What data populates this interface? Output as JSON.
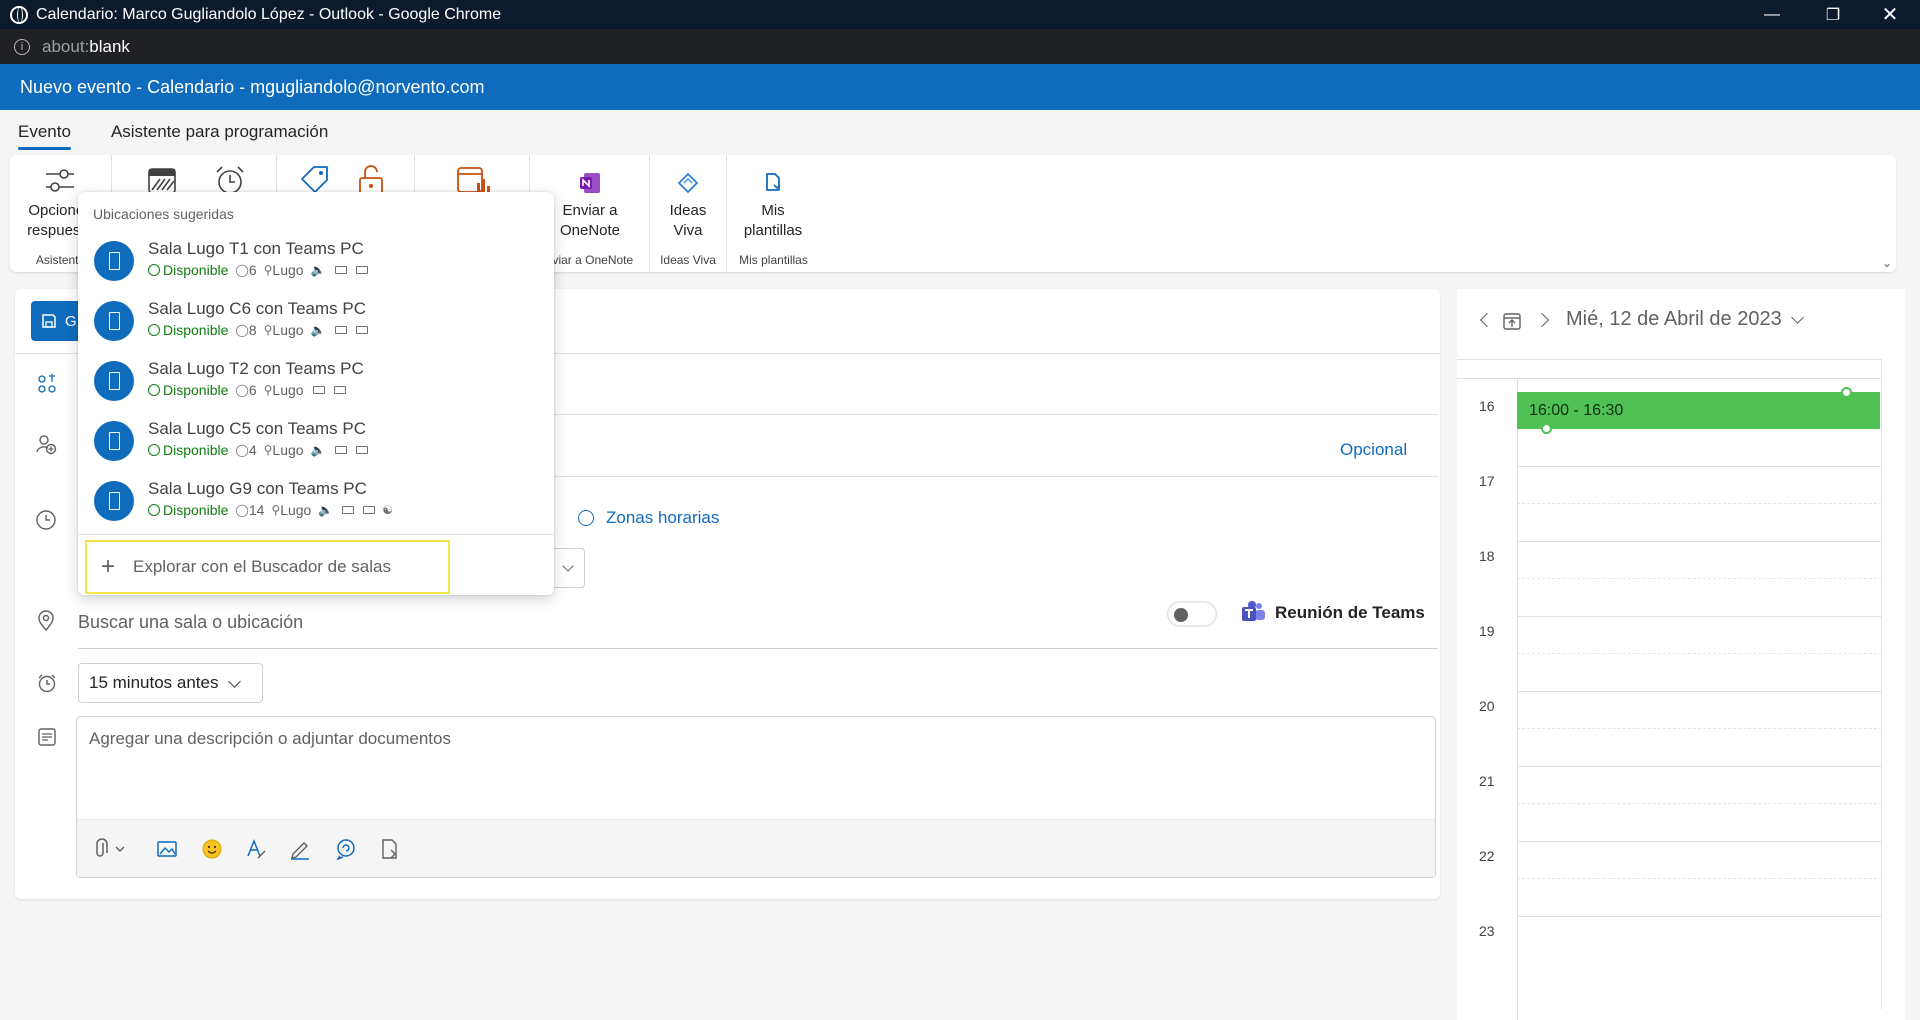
{
  "window": {
    "title": "Calendario: Marco Gugliandolo López - Outlook - Google Chrome",
    "address_scheme": "about:",
    "address_path": "blank"
  },
  "app_header": {
    "title": "Nuevo evento - Calendario - mgugliandolo@norvento.com"
  },
  "tabs": [
    {
      "label": "Evento",
      "active": true
    },
    {
      "label": "Asistente para programación",
      "active": false
    }
  ],
  "ribbon": {
    "groups": [
      {
        "buttons": [
          {
            "label_line1": "Opciones",
            "label_line2": "respuesta",
            "icon": "sliders-icon"
          }
        ],
        "group_label": "Asistente"
      },
      {
        "buttons": [
          {
            "label_line1": "",
            "label_line2": "",
            "icon": "calendar-busy-icon"
          },
          {
            "label_line1": "",
            "label_line2": "",
            "icon": "alarm-clock-icon"
          }
        ]
      },
      {
        "buttons": [
          {
            "label_line1": "",
            "label_line2": "",
            "icon": "tag-icon"
          },
          {
            "label_line1": "",
            "label_line2": "",
            "icon": "unlock-icon"
          }
        ]
      },
      {
        "buttons": [
          {
            "label_line1": "",
            "label_line2": "",
            "icon": "calendar-chart-icon"
          }
        ]
      },
      {
        "buttons": [
          {
            "label_line1": "Enviar a",
            "label_line2": "OneNote",
            "icon": "onenote-icon"
          }
        ],
        "group_label": "nviar a OneNote"
      },
      {
        "buttons": [
          {
            "label_line1": "Ideas",
            "label_line2": "Viva",
            "icon": "viva-icon"
          }
        ],
        "group_label": "Ideas Viva"
      },
      {
        "buttons": [
          {
            "label_line1": "Mis",
            "label_line2": "plantillas",
            "icon": "template-icon"
          }
        ],
        "group_label": "Mis plantillas"
      }
    ]
  },
  "event_form": {
    "save_label": "G",
    "optional_label": "Opcional",
    "timezones_label": "Zonas horarias",
    "location_placeholder": "Buscar una sala o ubicación",
    "teams_label": "Reunión de Teams",
    "teams_toggle_on": false,
    "reminder_value": "15 minutos antes",
    "description_placeholder": "Agregar una descripción o adjuntar documentos"
  },
  "suggestions": {
    "title": "Ubicaciones sugeridas",
    "items": [
      {
        "name": "Sala Lugo T1 con Teams PC",
        "status": "Disponible",
        "capacity": "6",
        "city": "Lugo"
      },
      {
        "name": "Sala Lugo C6 con Teams PC",
        "status": "Disponible",
        "capacity": "8",
        "city": "Lugo"
      },
      {
        "name": "Sala Lugo T2 con Teams PC",
        "status": "Disponible",
        "capacity": "6",
        "city": "Lugo"
      },
      {
        "name": "Sala Lugo C5 con Teams PC",
        "status": "Disponible",
        "capacity": "4",
        "city": "Lugo"
      },
      {
        "name": "Sala Lugo G9 con Teams PC",
        "status": "Disponible",
        "capacity": "14",
        "city": "Lugo"
      }
    ],
    "explore_label": "Explorar con el Buscador de salas"
  },
  "calendar": {
    "date_label": "Mié, 12 de Abril de 2023",
    "hours": [
      "16",
      "17",
      "18",
      "19",
      "20",
      "21",
      "22",
      "23"
    ],
    "event_label": "16:00 - 16:30",
    "event_color": "#4fc155"
  }
}
